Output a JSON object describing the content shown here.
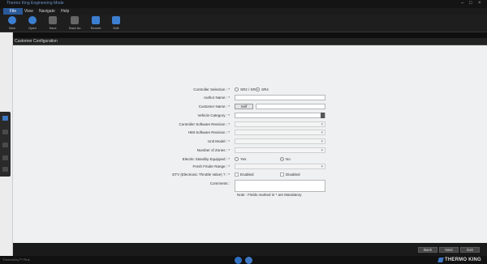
{
  "window": {
    "title": "Thermo King Engineering Mode"
  },
  "menu": {
    "items": [
      {
        "label": "File"
      },
      {
        "label": "View"
      },
      {
        "label": "Navigate"
      },
      {
        "label": "Help"
      }
    ]
  },
  "toolbar": {
    "items": [
      {
        "label": "New",
        "icon": "new-file-icon",
        "color": "#3c7fd1"
      },
      {
        "label": "Open",
        "icon": "open-folder-icon",
        "color": "#3c7fd1"
      },
      {
        "label": "Save",
        "icon": "save-icon",
        "color": "#666666"
      },
      {
        "label": "Save As",
        "icon": "save-as-icon",
        "color": "#666666"
      },
      {
        "label": "Recent",
        "icon": "recent-icon",
        "color": "#3c7fd1"
      },
      {
        "label": "Edit",
        "icon": "edit-icon",
        "color": "#3c7fd1"
      }
    ]
  },
  "panel": {
    "title": "Customer Configuration"
  },
  "form": {
    "controller_selection": {
      "label": "Controller Selection : *",
      "options": [
        {
          "label": "SR2 / SR3",
          "selected": false
        },
        {
          "label": "SR4",
          "selected": true
        }
      ]
    },
    "author_name": {
      "label": "Author Name : *",
      "value": ""
    },
    "customer_name": {
      "label": "Customer Name : *",
      "button_label": "Self",
      "value": ""
    },
    "vehicle_category": {
      "label": "Vehicle Category : *",
      "value": ""
    },
    "controller_software_revision": {
      "label": "Controller Software Revision : *",
      "value": ""
    },
    "hmi_software_revision": {
      "label": "HMI Software Revision : *",
      "value": ""
    },
    "unit_model": {
      "label": "Unit Model : *",
      "value": ""
    },
    "number_of_zones": {
      "label": "Number of Zones : *",
      "value": ""
    },
    "electric_standby_equipped": {
      "label": "Electric Standby Equipped : *",
      "options": [
        {
          "label": "Yes",
          "selected": false
        },
        {
          "label": "No",
          "selected": true
        }
      ]
    },
    "fresh_finder_range": {
      "label": "Fresh Finder Range : *",
      "value": ""
    },
    "etv": {
      "label": "ETV (Electronic Throttle Valve) ? : *",
      "options": [
        {
          "label": "Enabled",
          "selected": false
        },
        {
          "label": "Disabled",
          "selected": false
        }
      ]
    },
    "comments": {
      "label": "Comments :",
      "value": ""
    },
    "note": "Note : Fields marked in * are Mandatory"
  },
  "navigation": {
    "back_label": "Back",
    "next_label": "Next",
    "exit_label": "Exit"
  },
  "status": {
    "version": "ThermoKey™ Plus"
  },
  "brand": {
    "logo_text": "THERMO KING",
    "accent": "#3e78c4"
  }
}
